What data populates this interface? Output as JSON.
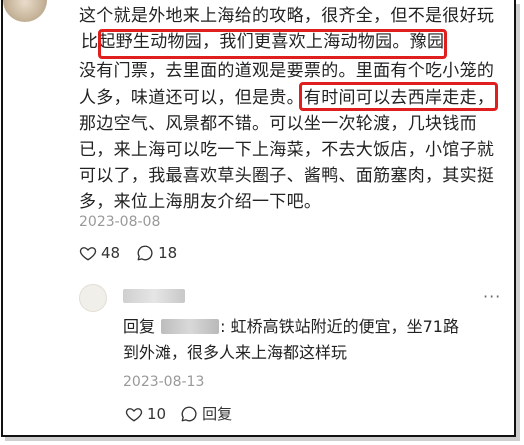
{
  "comment": {
    "line1": "这个就是外地来上海给的攻略，很齐全，但不是很好玩",
    "line2_highlight": "比起野生动物园，我们更喜欢上海动物园。",
    "line2_rest": "豫园",
    "line3": "没有门票，去里面的道观是要票的。里面有个吃小笼的",
    "line4_start": "人多，味道还可以，但是贵。",
    "line4_highlight": "有时间可以去西岸走走",
    "line4_end": "，",
    "line5": "那边空气、风景都不错。可以坐一次轮渡，几块钱而",
    "line6": "已，来上海可以吃一下上海菜，不去大饭店，小馆子就",
    "line7": "可以了，我最喜欢草头圈子、酱鸭、面筋塞肉，其实挺",
    "line8": "多，来位上海朋友介绍一下吧。",
    "date": "2023-08-08",
    "likes": "48",
    "comments": "18"
  },
  "reply": {
    "prefix": "回复",
    "text_line1": ": 虹桥高铁站附近的便宜，坐71路",
    "text_line2": "到外滩，很多人来上海都这样玩",
    "date": "2023-08-13",
    "likes": "10",
    "reply_label": "回复"
  },
  "icons": {
    "heart": "heart-icon",
    "comment": "comment-icon",
    "more": "more-icon"
  },
  "colors": {
    "highlight": "#e01e1e",
    "muted": "#999999",
    "text": "#222222"
  }
}
